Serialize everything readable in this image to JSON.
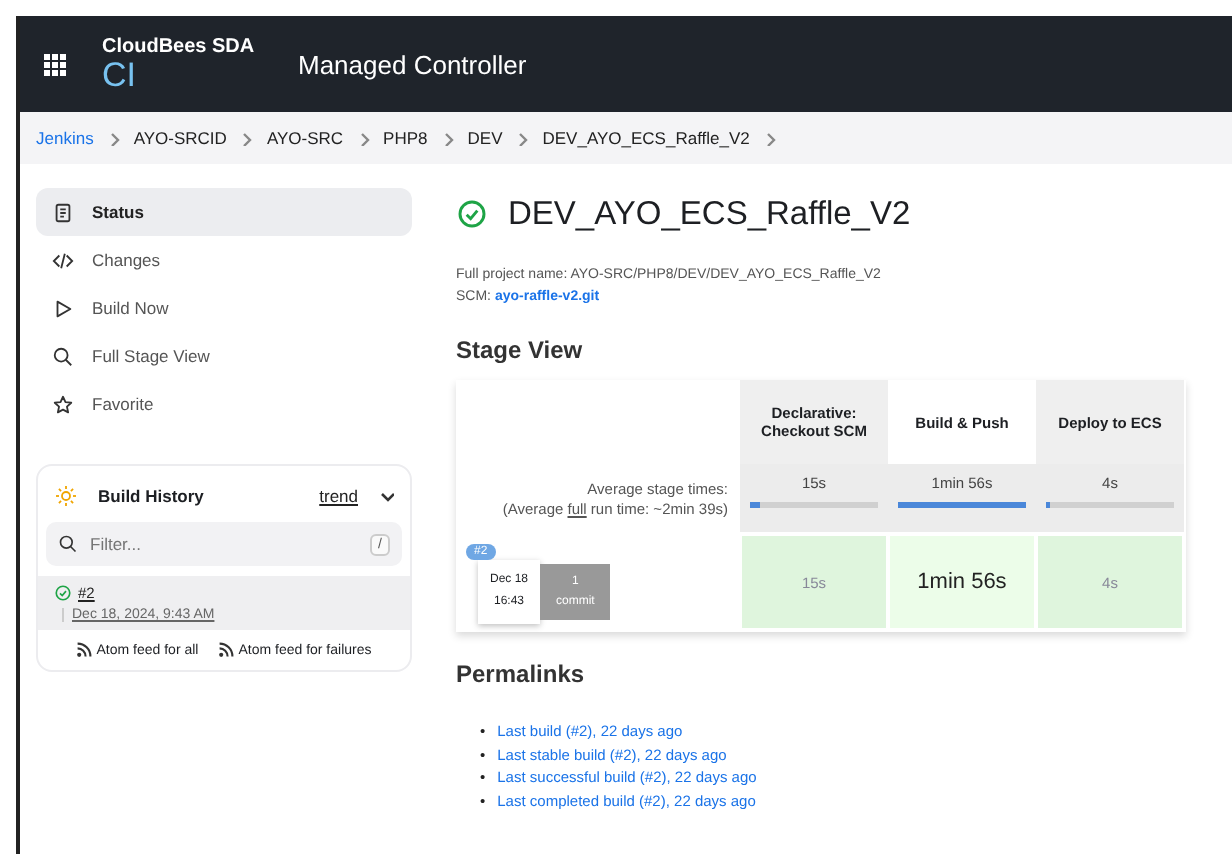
{
  "header": {
    "brand_small": "CloudBees SDA",
    "brand": "CI",
    "title": "Managed Controller"
  },
  "breadcrumbs": [
    {
      "label": "Jenkins",
      "kind": "link"
    },
    {
      "label": "AYO-SRCID",
      "kind": "plain"
    },
    {
      "label": "AYO-SRC",
      "kind": "plain"
    },
    {
      "label": "PHP8",
      "kind": "plain"
    },
    {
      "label": "DEV",
      "kind": "plain"
    },
    {
      "label": "DEV_AYO_ECS_Raffle_V2",
      "kind": "plain"
    }
  ],
  "sidebar": {
    "items": [
      {
        "label": "Status",
        "kind": "document",
        "selected": true
      },
      {
        "label": "Changes",
        "kind": "code",
        "selected": false
      },
      {
        "label": "Build Now",
        "kind": "play",
        "selected": false
      },
      {
        "label": "Full Stage View",
        "kind": "search",
        "selected": false
      },
      {
        "label": "Favorite",
        "kind": "star",
        "selected": false
      }
    ]
  },
  "build_history": {
    "title": "Build History",
    "trend": "trend",
    "filter": {
      "placeholder": "Filter...",
      "shortcut": "/"
    },
    "builds": [
      {
        "number": "#2",
        "date": "Dec 18, 2024, 9:43 AM",
        "kind": "success"
      }
    ],
    "feeds": [
      "Atom feed for all",
      "Atom feed for failures"
    ]
  },
  "job": {
    "kind": "success",
    "name": "DEV_AYO_ECS_Raffle_V2",
    "full_name": "Full project name: AYO-SRC/PHP8/DEV/DEV_AYO_ECS_Raffle_V2",
    "scm_label": "SCM:",
    "scm_link": "ayo-raffle-v2.git"
  },
  "stage_view": {
    "title": "Stage View",
    "average_label": "Average stage times:",
    "run_time_prefix": "(Average",
    "run_time_link": "full",
    "run_time_suffix": "run time: ~2min 39s)",
    "stages": [
      {
        "name": "Declarative: Checkout SCM",
        "average": "15s",
        "level": 0.08,
        "highlighted": false
      },
      {
        "name": "Build & Push",
        "average": "1min 56s",
        "level": 1,
        "highlighted": true
      },
      {
        "name": "Deploy to ECS",
        "average": "4s",
        "level": 0.03,
        "highlighted": false
      }
    ],
    "runs": [
      {
        "number": "#2",
        "date": "Dec 18",
        "time": "16:43",
        "commits": "1",
        "commits_label": "commit",
        "durations": [
          "15s",
          "1min 56s",
          "4s"
        ]
      }
    ]
  },
  "permalinks": {
    "title": "Permalinks",
    "links": [
      {
        "marker": "•",
        "label": "Last build (#2), 22 days ago"
      },
      {
        "marker": "•",
        "label": "Last stable build (#2), 22 days ago"
      },
      {
        "marker": "•",
        "label": "Last successful build (#2), 22 days ago"
      },
      {
        "marker": "•",
        "label": "Last completed build (#2), 22 days ago"
      }
    ]
  }
}
